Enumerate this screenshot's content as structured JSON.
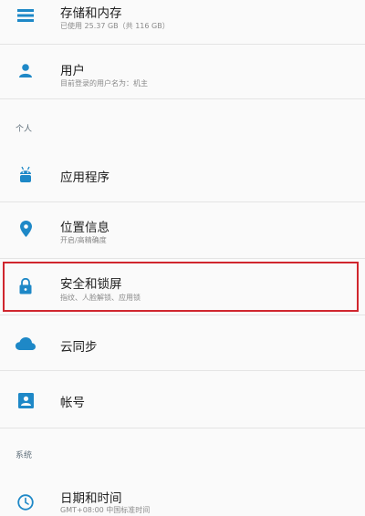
{
  "colors": {
    "accent": "#1e88c7",
    "highlight": "#d0262e"
  },
  "items": {
    "storage": {
      "title": "存储和内存",
      "subtitle": "已使用 25.37 GB（共 116 GB）",
      "icon": "storage-list-icon"
    },
    "user": {
      "title": "用户",
      "subtitle": "目前登录的用户名为：机主",
      "icon": "person-icon"
    },
    "apps": {
      "title": "应用程序",
      "icon": "android-icon"
    },
    "location": {
      "title": "位置信息",
      "subtitle": "开启/高精确度",
      "icon": "location-pin-icon"
    },
    "security": {
      "title": "安全和锁屏",
      "subtitle": "指纹、人脸解锁、应用锁",
      "icon": "lock-icon"
    },
    "cloud": {
      "title": "云同步",
      "icon": "cloud-icon"
    },
    "account": {
      "title": "帐号",
      "icon": "account-box-icon"
    },
    "datetime": {
      "title": "日期和时间",
      "subtitle": "GMT+08:00 中国标准时间",
      "icon": "clock-icon"
    }
  },
  "sections": {
    "personal": "个人",
    "system": "系统"
  }
}
